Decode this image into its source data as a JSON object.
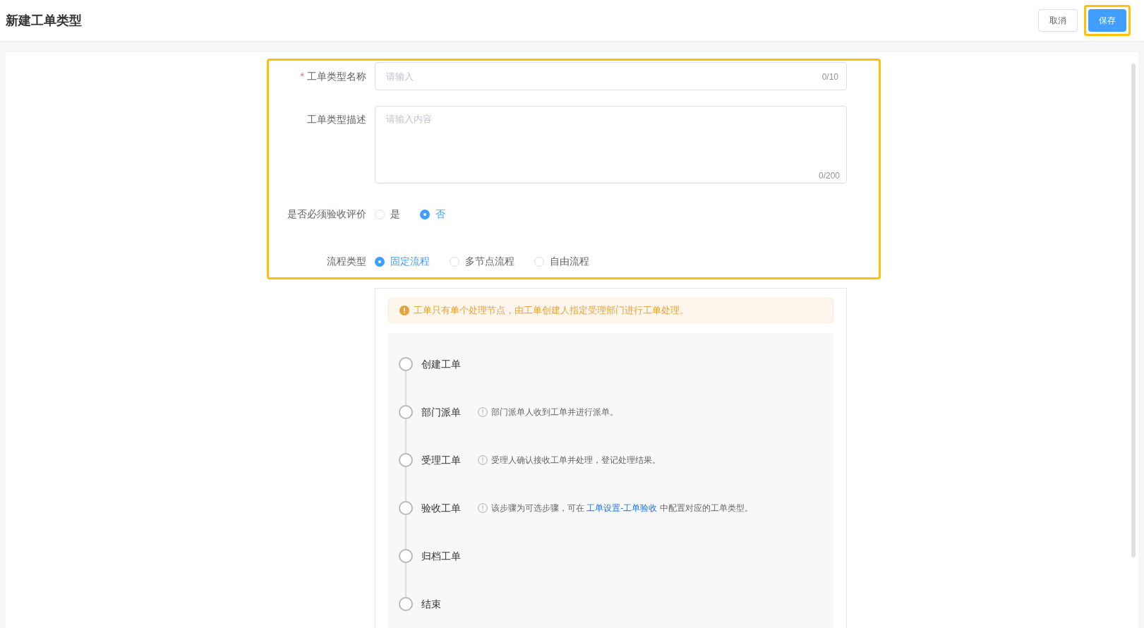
{
  "header": {
    "title": "新建工单类型",
    "buttons": [
      {
        "label": "取消",
        "kind": "default",
        "highlighted": false
      },
      {
        "label": "保存",
        "kind": "primary",
        "highlighted": true
      }
    ]
  },
  "form": {
    "highlighted": true,
    "name_field": {
      "label": "工单类型名称",
      "required_mark": "*",
      "placeholder": "请输入",
      "counter": "0/10"
    },
    "desc_field": {
      "label": "工单类型描述",
      "placeholder": "请输入内容",
      "counter": "0/200"
    },
    "radio_groups": [
      {
        "label": "是否必须验收评价",
        "options": [
          {
            "label": "是",
            "selected": false
          },
          {
            "label": "否",
            "selected": true
          }
        ]
      },
      {
        "label": "流程类型",
        "options": [
          {
            "label": "固定流程",
            "selected": true
          },
          {
            "label": "多节点流程",
            "selected": false
          },
          {
            "label": "自由流程",
            "selected": false
          }
        ]
      }
    ]
  },
  "flow": {
    "alert": "工单只有单个处理节点，由工单创建人指定受理部门进行工单处理。",
    "steps": [
      {
        "title": "创建工单"
      },
      {
        "title": "部门派单",
        "note": {
          "text": "部门派单人收到工单并进行派单。"
        }
      },
      {
        "title": "受理工单",
        "note": {
          "text": "受理人确认接收工单并处理，登记处理结果。"
        }
      },
      {
        "title": "验收工单",
        "note": {
          "text": "该步骤为可选步骤，可在 ",
          "link": "工单设置-工单验收",
          "after": " 中配置对应的工单类型。"
        }
      },
      {
        "title": "归档工单"
      },
      {
        "title": "结束"
      }
    ]
  }
}
